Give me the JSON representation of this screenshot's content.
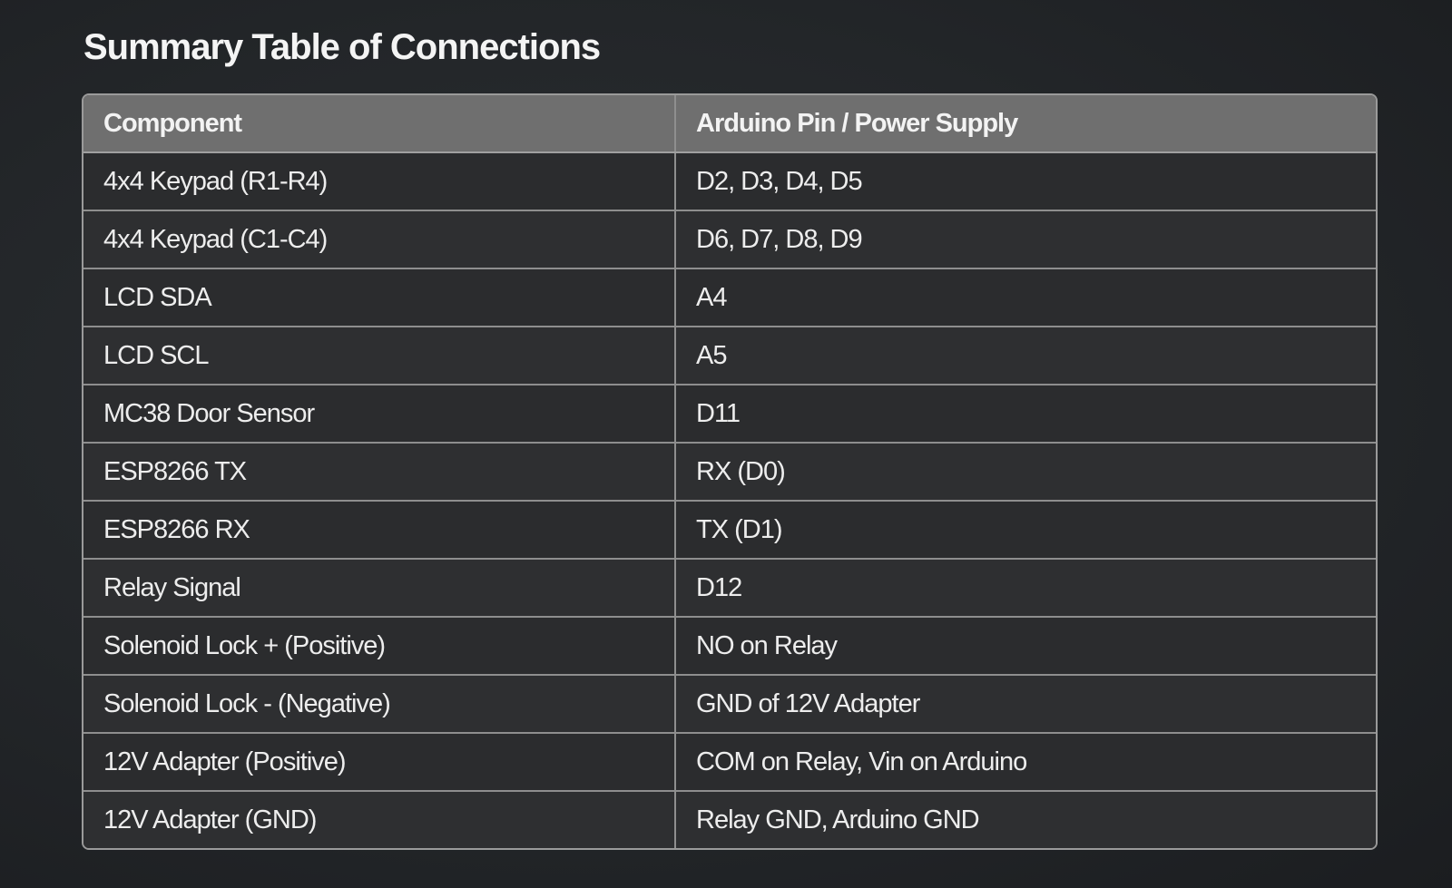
{
  "title": "Summary Table of Connections",
  "table": {
    "headers": [
      "Component",
      "Arduino Pin / Power Supply"
    ],
    "rows": [
      [
        "4x4 Keypad (R1-R4)",
        "D2, D3, D4, D5"
      ],
      [
        "4x4 Keypad (C1-C4)",
        "D6, D7, D8, D9"
      ],
      [
        "LCD SDA",
        "A4"
      ],
      [
        "LCD SCL",
        "A5"
      ],
      [
        "MC38 Door Sensor",
        "D11"
      ],
      [
        "ESP8266 TX",
        "RX (D0)"
      ],
      [
        "ESP8266 RX",
        "TX (D1)"
      ],
      [
        "Relay Signal",
        "D12"
      ],
      [
        "Solenoid Lock + (Positive)",
        "NO on Relay"
      ],
      [
        "Solenoid Lock - (Negative)",
        "GND of 12V Adapter"
      ],
      [
        "12V Adapter (Positive)",
        "COM on Relay, Vin on Arduino"
      ],
      [
        "12V Adapter (GND)",
        "Relay GND, Arduino GND"
      ]
    ]
  }
}
